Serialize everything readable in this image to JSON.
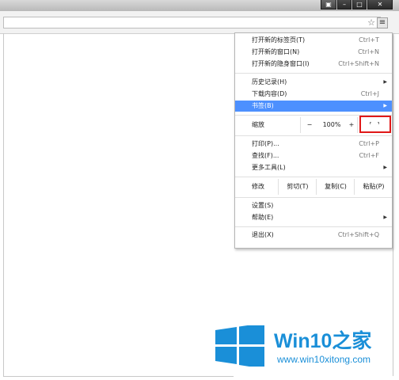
{
  "window": {
    "controls": [
      "⁠▣",
      "–",
      "□",
      "✕"
    ]
  },
  "toolbar": {
    "bookmark_icon": "star-icon",
    "menu_icon": "hamburger-menu-icon"
  },
  "menu": {
    "new_tab": {
      "label": "打开新的标签页(T)",
      "shortcut": "Ctrl+T"
    },
    "new_window": {
      "label": "打开新的窗口(N)",
      "shortcut": "Ctrl+N"
    },
    "new_incognito": {
      "label": "打开新的隐身窗口(I)",
      "shortcut": "Ctrl+Shift+N"
    },
    "history": {
      "label": "历史记录(H)"
    },
    "downloads": {
      "label": "下载内容(D)",
      "shortcut": "Ctrl+J"
    },
    "bookmarks": {
      "label": "书签(B)"
    },
    "zoom": {
      "label": "缩放",
      "minus": "−",
      "value": "100%",
      "plus": "+",
      "fullscreen_icon": "⸢ ⸣"
    },
    "print": {
      "label": "打印(P)...",
      "shortcut": "Ctrl+P"
    },
    "find": {
      "label": "查找(F)...",
      "shortcut": "Ctrl+F"
    },
    "more_tools": {
      "label": "更多工具(L)"
    },
    "edit": {
      "label": "修改",
      "cut": "剪切(T)",
      "copy": "复制(C)",
      "paste": "粘贴(P)"
    },
    "settings": {
      "label": "设置(S)"
    },
    "help": {
      "label": "帮助(E)"
    },
    "exit": {
      "label": "退出(X)",
      "shortcut": "Ctrl+Shift+Q"
    }
  },
  "watermark": {
    "brand_main": "Win10",
    "brand_accent": "之家",
    "url": "www.win10xitong.com"
  },
  "colors": {
    "accent": "#4d90fe",
    "highlight_box": "#e01818",
    "brand": "#1a8fd8"
  }
}
